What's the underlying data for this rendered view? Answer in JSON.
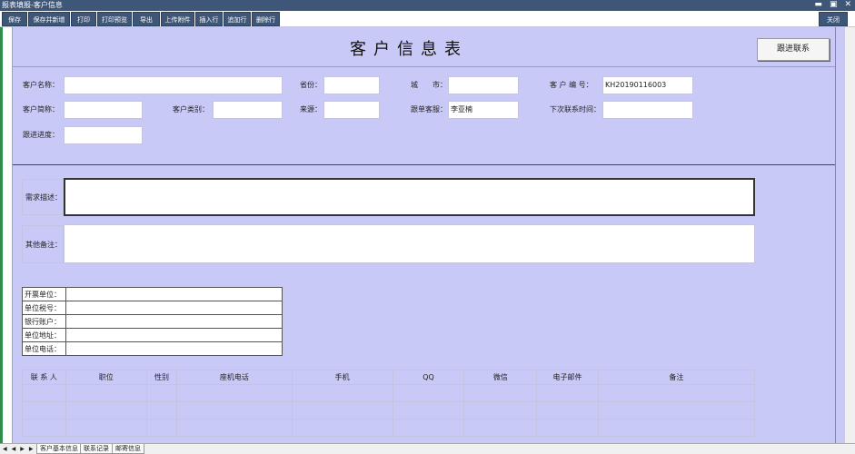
{
  "window": {
    "title": "报表填报-客户信息",
    "minimize": "▬",
    "restore": "▣",
    "close": "✕"
  },
  "toolbar": {
    "save": "保存",
    "save_new": "保存并新增",
    "print": "打印",
    "print_preview": "打印预览",
    "export": "导出",
    "upload": "上传附件",
    "insert_row": "插入行",
    "append_row": "追加行",
    "delete_row": "删除行",
    "close": "关闭"
  },
  "form": {
    "title": "客户信息表",
    "follow_button": "跟进联系",
    "customer_name_label": "客户名称：",
    "customer_name_value": "",
    "province_label": "省份：",
    "province_value": "",
    "city_label": "城　　市：",
    "city_value": "",
    "customer_no_label": "客 户 编 号：",
    "customer_no_value": "KH20190116003",
    "short_name_label": "客户简称：",
    "short_name_value": "",
    "category_label": "客户类别：",
    "category_value": "",
    "source_label": "来源：",
    "source_value": "",
    "service_label": "跟单客服：",
    "service_value": "李亚楠",
    "next_contact_label": "下次联系时间：",
    "next_contact_value": "",
    "progress_label": "跟进进度：",
    "progress_value": "",
    "demand_label": "需求描述：",
    "demand_value": "",
    "remark_label": "其他备注：",
    "remark_value": ""
  },
  "bank": {
    "rows": [
      {
        "label": "开票单位：",
        "value": ""
      },
      {
        "label": "单位税号：",
        "value": ""
      },
      {
        "label": "银行账户：",
        "value": ""
      },
      {
        "label": "单位地址：",
        "value": ""
      },
      {
        "label": "单位电话：",
        "value": ""
      }
    ]
  },
  "contacts": {
    "headers": [
      "联 系 人",
      "职位",
      "性别",
      "座机电话",
      "手机",
      "QQ",
      "微信",
      "电子邮件",
      "备注"
    ]
  },
  "tabs": {
    "nav": [
      "◀",
      "◀",
      "▶",
      "▶"
    ],
    "items": [
      "客户基本信息",
      "联系记录",
      "邮寄信息"
    ]
  }
}
